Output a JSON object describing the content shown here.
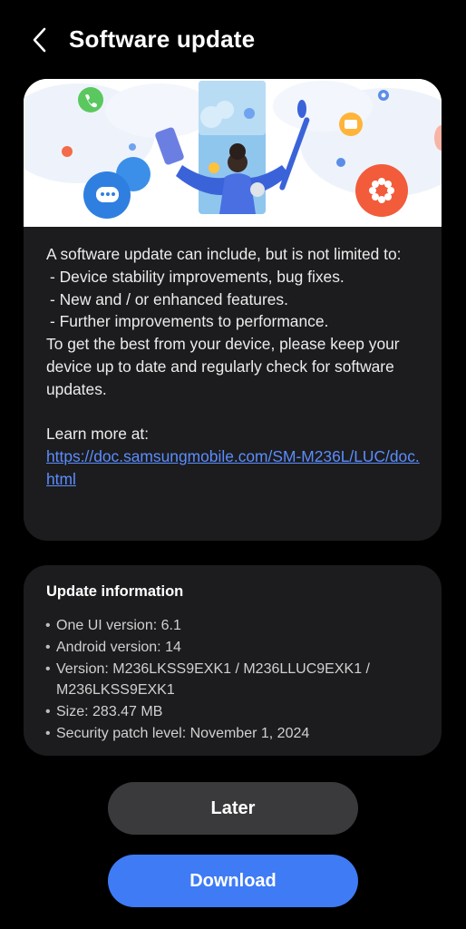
{
  "header": {
    "title": "Software update"
  },
  "description": {
    "intro": "A software update can include, but is not limited to:",
    "items": [
      " - Device stability improvements, bug fixes.",
      " - New and / or enhanced features.",
      " - Further improvements to performance."
    ],
    "advice": "To get the best from your device, please keep your device up to date and regularly check for software updates.",
    "learn_more_label": "Learn more at:",
    "link": "https://doc.samsungmobile.com/SM-M236L/LUC/doc.html"
  },
  "update_info": {
    "title": "Update information",
    "items": [
      "One UI version: 6.1",
      "Android version: 14",
      "Version: M236LKSS9EXK1 / M236LLUC9EXK1 / M236LKSS9EXK1",
      "Size: 283.47 MB",
      "Security patch level: November 1, 2024"
    ]
  },
  "buttons": {
    "later": "Later",
    "download": "Download"
  },
  "colors": {
    "background": "#000000",
    "card": "#1c1c1e",
    "link": "#5b8dff",
    "primary_button": "#3e7bf5",
    "secondary_button": "#3a3a3c"
  }
}
